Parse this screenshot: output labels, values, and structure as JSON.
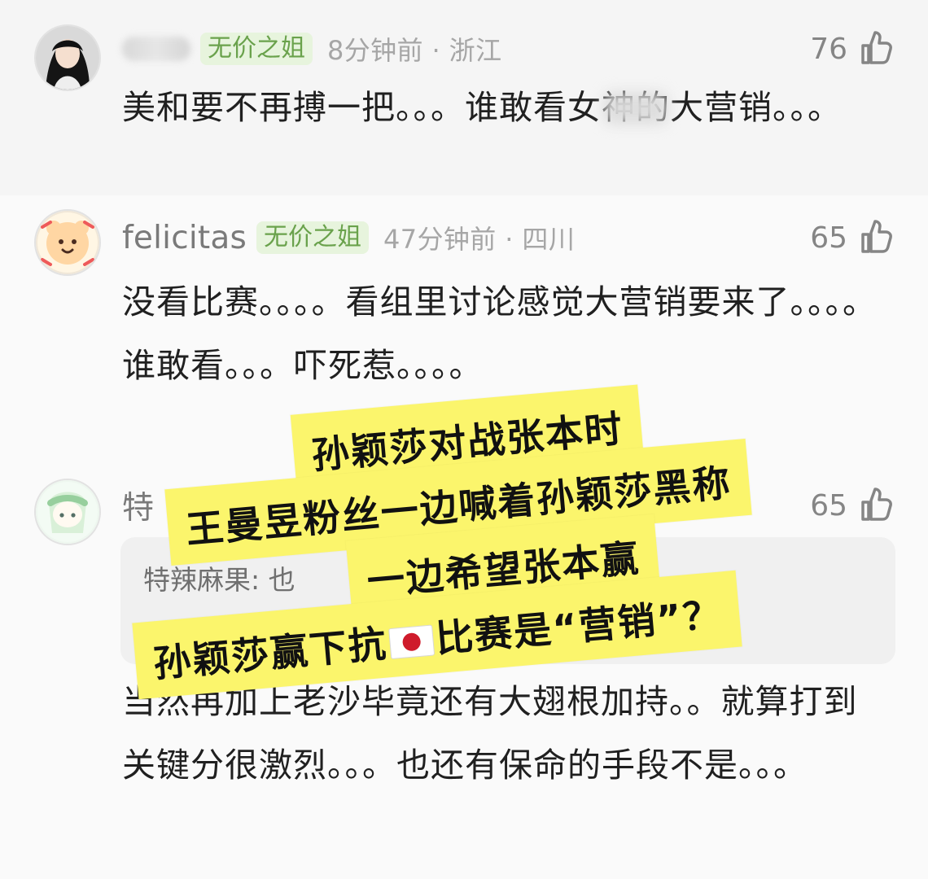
{
  "comments": [
    {
      "username": "",
      "badge": "无价之姐",
      "meta": "8分钟前 · 浙江",
      "likes": "76",
      "text": "美和要不再搏一把。。。谁敢看女神的大营销。。。"
    },
    {
      "username": "felicitas",
      "badge": "无价之姐",
      "meta": "47分钟前 · 四川",
      "likes": "65",
      "text": "没看比赛。。。。看组里讨论感觉大营销要来了。。。。谁敢看。。。吓死惹。。。。"
    },
    {
      "username": "特",
      "likes": "65",
      "reply_author": "特辣麻果:",
      "reply_text": "也",
      "text": "当然再加上老沙毕竟还有大翅根加持。。就算打到关键分很激烈。。。也还有保命的手段不是。。。"
    }
  ],
  "overlay_lines": [
    "孙颖莎对战张本时",
    "王曼昱粉丝一边喊着孙颖莎黑称",
    "一边希望张本赢",
    "孙颖莎赢下抗",
    "比赛是“营销”？"
  ],
  "colors": {
    "page_background": "#f7f7f7",
    "badge_green": "#6aa24c",
    "badge_background": "#e7f4dd",
    "overlay_yellow": "#fbf56c",
    "flag_red": "#cf1b2b"
  },
  "icons": {
    "like": "thumbs-up-icon",
    "flag": "japan-flag-icon"
  }
}
